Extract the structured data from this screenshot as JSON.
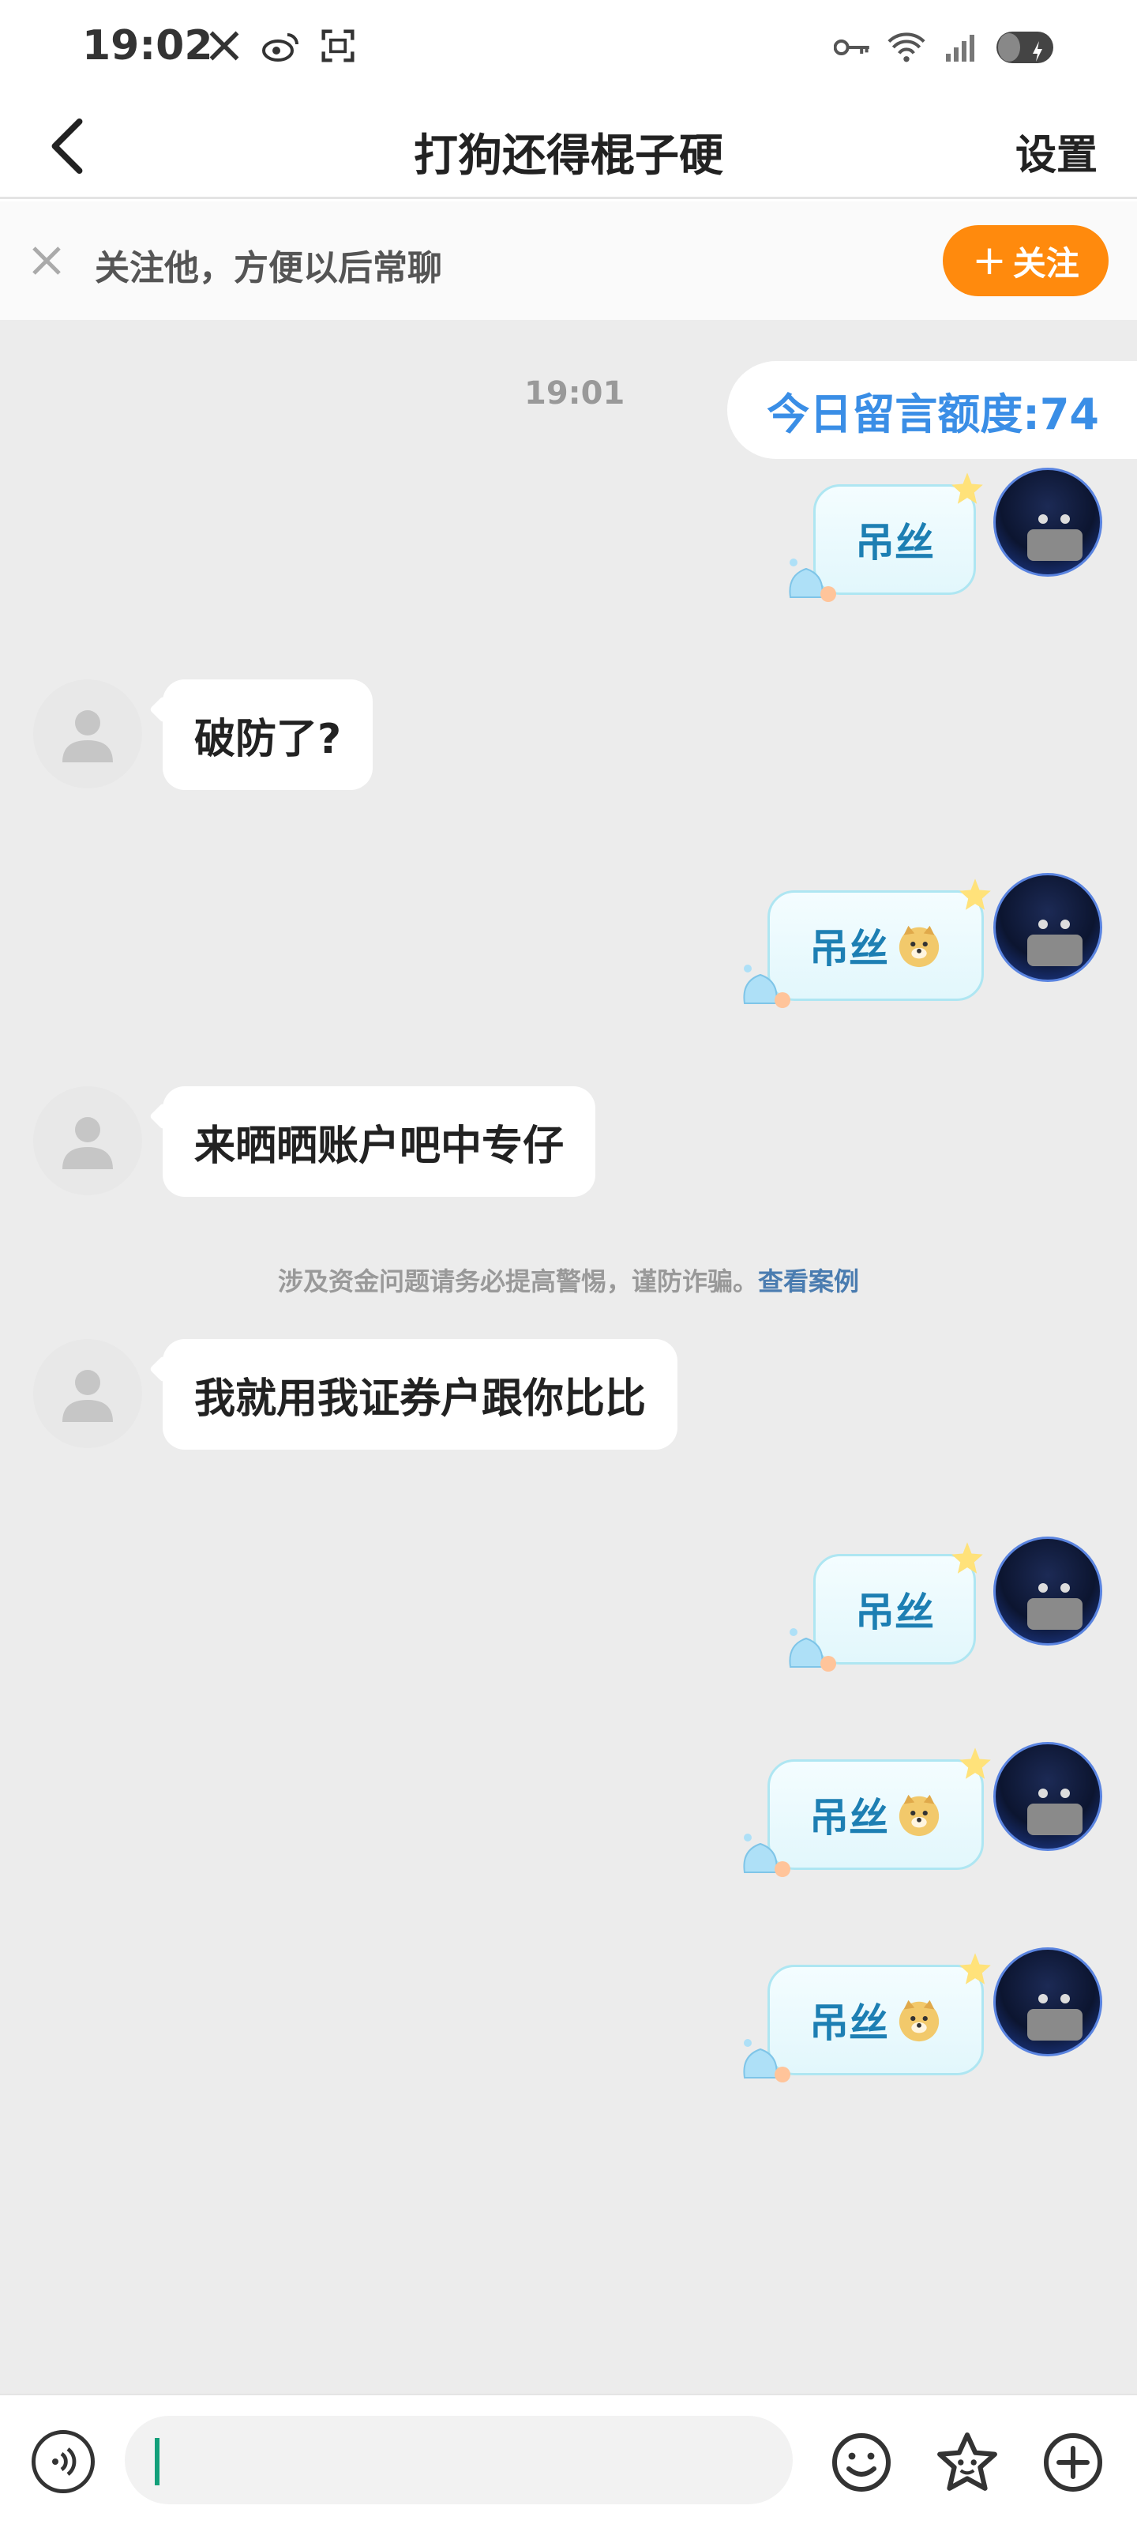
{
  "status_bar": {
    "time": "19:02"
  },
  "nav": {
    "title": "打狗还得棍子硬",
    "settings_label": "设置"
  },
  "follow_banner": {
    "text": "关注他，方便以后常聊",
    "button_label": "关注",
    "button_plus": "+"
  },
  "chat": {
    "quota": "今日留言额度:74",
    "timestamp": "19:01",
    "messages": [
      {
        "side": "right",
        "text": "吊丝",
        "emoji": ""
      },
      {
        "side": "left",
        "text": "破防了?"
      },
      {
        "side": "right",
        "text": "吊丝",
        "emoji": "doge"
      },
      {
        "side": "left",
        "text": "来晒晒账户吧中专仔"
      },
      {
        "side": "left",
        "text": "我就用我证券户跟你比比"
      },
      {
        "side": "right",
        "text": "吊丝",
        "emoji": ""
      },
      {
        "side": "right",
        "text": "吊丝",
        "emoji": "doge"
      },
      {
        "side": "right",
        "text": "吊丝",
        "emoji": "doge"
      }
    ],
    "warning_text": "涉及资金问题请务必提高警惕，谨防诈骗。",
    "warning_link": "查看案例"
  },
  "input_bar": {
    "value": "",
    "placeholder": ""
  },
  "colors": {
    "accent_orange": "#ff8a0d",
    "quota_blue": "#3a8ee6",
    "bubble_text": "#1d7fb3",
    "caret_green": "#13a07a"
  },
  "icons": [
    "x-logo-icon",
    "weibo-icon",
    "scan-icon",
    "key-icon",
    "wifi-icon",
    "signal-icon",
    "battery-icon",
    "back-arrow-icon",
    "close-icon",
    "voice-icon",
    "emoji-icon",
    "sticker-icon",
    "plus-icon"
  ]
}
